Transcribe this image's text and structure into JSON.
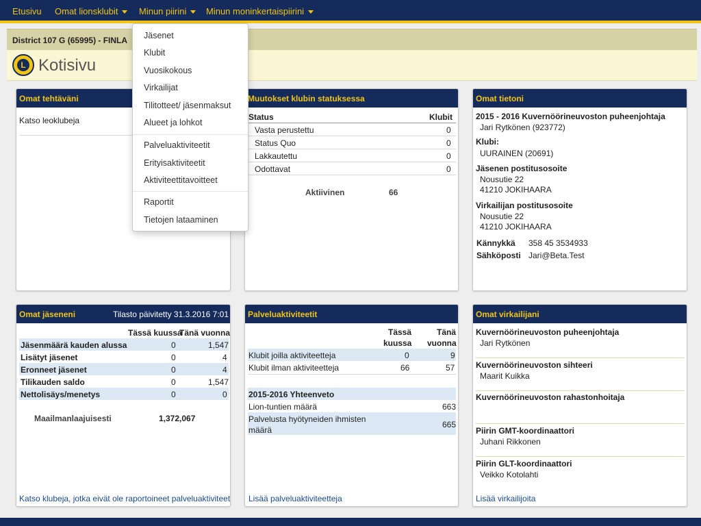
{
  "nav": {
    "home": "Etusivu",
    "clubs": "Omat lionsklubit",
    "district": "Minun piirini",
    "multiple": "Minun moninkertaispiirini"
  },
  "dropdown": {
    "items": [
      "Jäsenet",
      "Klubit",
      "Vuosikokous",
      "Virkailijat",
      "Tilitotteet/ jäsenmaksut",
      "Alueet ja lohkot",
      "Palveluaktiviteetit",
      "Erityisaktiviteetit",
      "Aktiviteettitavoitteet",
      "Raportit",
      "Tietojen lataaminen"
    ]
  },
  "header": {
    "district": "District 107 G (65995) - FINLA",
    "title": "Kotisivu"
  },
  "tasks": {
    "title": "Omat tehtäväni",
    "item": "Katso leoklubeja"
  },
  "status": {
    "title": "Muutokset klubin statuksessa",
    "col_status": "Status",
    "col_clubs": "Klubit",
    "rows": [
      {
        "label": "Vasta perustettu",
        "value": "0"
      },
      {
        "label": "Status Quo",
        "value": "0"
      },
      {
        "label": "Lakkautettu",
        "value": "0"
      },
      {
        "label": "Odottavat",
        "value": "0"
      }
    ],
    "active_label": "Aktiivinen",
    "active_value": "66"
  },
  "info": {
    "title": "Omat tietoni",
    "role": "2015 - 2016 Kuvernöörineuvoston puheenjohtaja",
    "name": "Jari Rytkönen (923772)",
    "club_label": "Klubi:",
    "club": "UURAINEN (20691)",
    "member_addr_label": "Jäsenen postitusosoite",
    "member_addr1": "Nousutie 22",
    "member_addr2": "41210 JOKIHAARA",
    "officer_addr_label": "Virkailijan postitusosoite",
    "officer_addr1": "Nousutie 22",
    "officer_addr2": "41210 JOKIHAARA",
    "mobile_label": "Kännykkä",
    "mobile": "358 45 3534933",
    "email_label": "Sähköposti",
    "email": "Jari@Beta.Test"
  },
  "members": {
    "title": "Omat jäseneni",
    "updated": "Tilasto päivitetty 31.3.2016 7:01",
    "col_month": "Tässä kuussa",
    "col_year": "Tänä vuonna",
    "rows": [
      {
        "label": "Jäsenmäärä kauden alussa",
        "month": "0",
        "year": "1,547"
      },
      {
        "label": "Lisätyt jäsenet",
        "month": "0",
        "year": "4"
      },
      {
        "label": "Eronneet jäsenet",
        "month": "0",
        "year": "4"
      },
      {
        "label": "Tilikauden saldo",
        "month": "0",
        "year": "1,547"
      },
      {
        "label": "Nettolisäys/menetys",
        "month": "0",
        "year": "0"
      }
    ],
    "world_label": "Maailmanlaajuisesti",
    "world_value": "1,372,067",
    "link": "Katso klubeja, jotka eivät ole raportoineet palveluaktiviteetteja"
  },
  "service": {
    "title": "Palveluaktiviteetit",
    "col_month_1": "Tässä",
    "col_month_2": "kuussa",
    "col_year_1": "Tänä",
    "col_year_2": "vuonna",
    "rows": [
      {
        "label": "Klubit joilla aktiviteetteja",
        "month": "0",
        "year": "9"
      },
      {
        "label": "Klubit ilman aktiviteetteja",
        "month": "66",
        "year": "57"
      }
    ],
    "summary_title": "2015-2016 Yhteenveto",
    "hours_label": "Lion-tuntien määrä",
    "hours_value": "663",
    "people_label_1": "Palvelusta hyötyneiden ihmisten",
    "people_label_2": "määrä",
    "people_value": "665",
    "link": "Lisää palveluaktiviteetteja"
  },
  "officers": {
    "title": "Omat virkailijani",
    "items": [
      {
        "role": "Kuvernöörineuvoston puheenjohtaja",
        "name": "Jari Rytkönen"
      },
      {
        "role": "Kuvernöörineuvoston sihteeri",
        "name": "Maarit Kuikka"
      },
      {
        "role": "Kuvernöörineuvoston rahastonhoitaja",
        "name": ""
      },
      {
        "role": "Piirin GMT-koordinaattori",
        "name": "Juhani Rikkonen"
      },
      {
        "role": "Piirin GLT-koordinaattori",
        "name": "Veikko Kotolahti"
      }
    ],
    "link": "Lisää virkailijoita"
  }
}
